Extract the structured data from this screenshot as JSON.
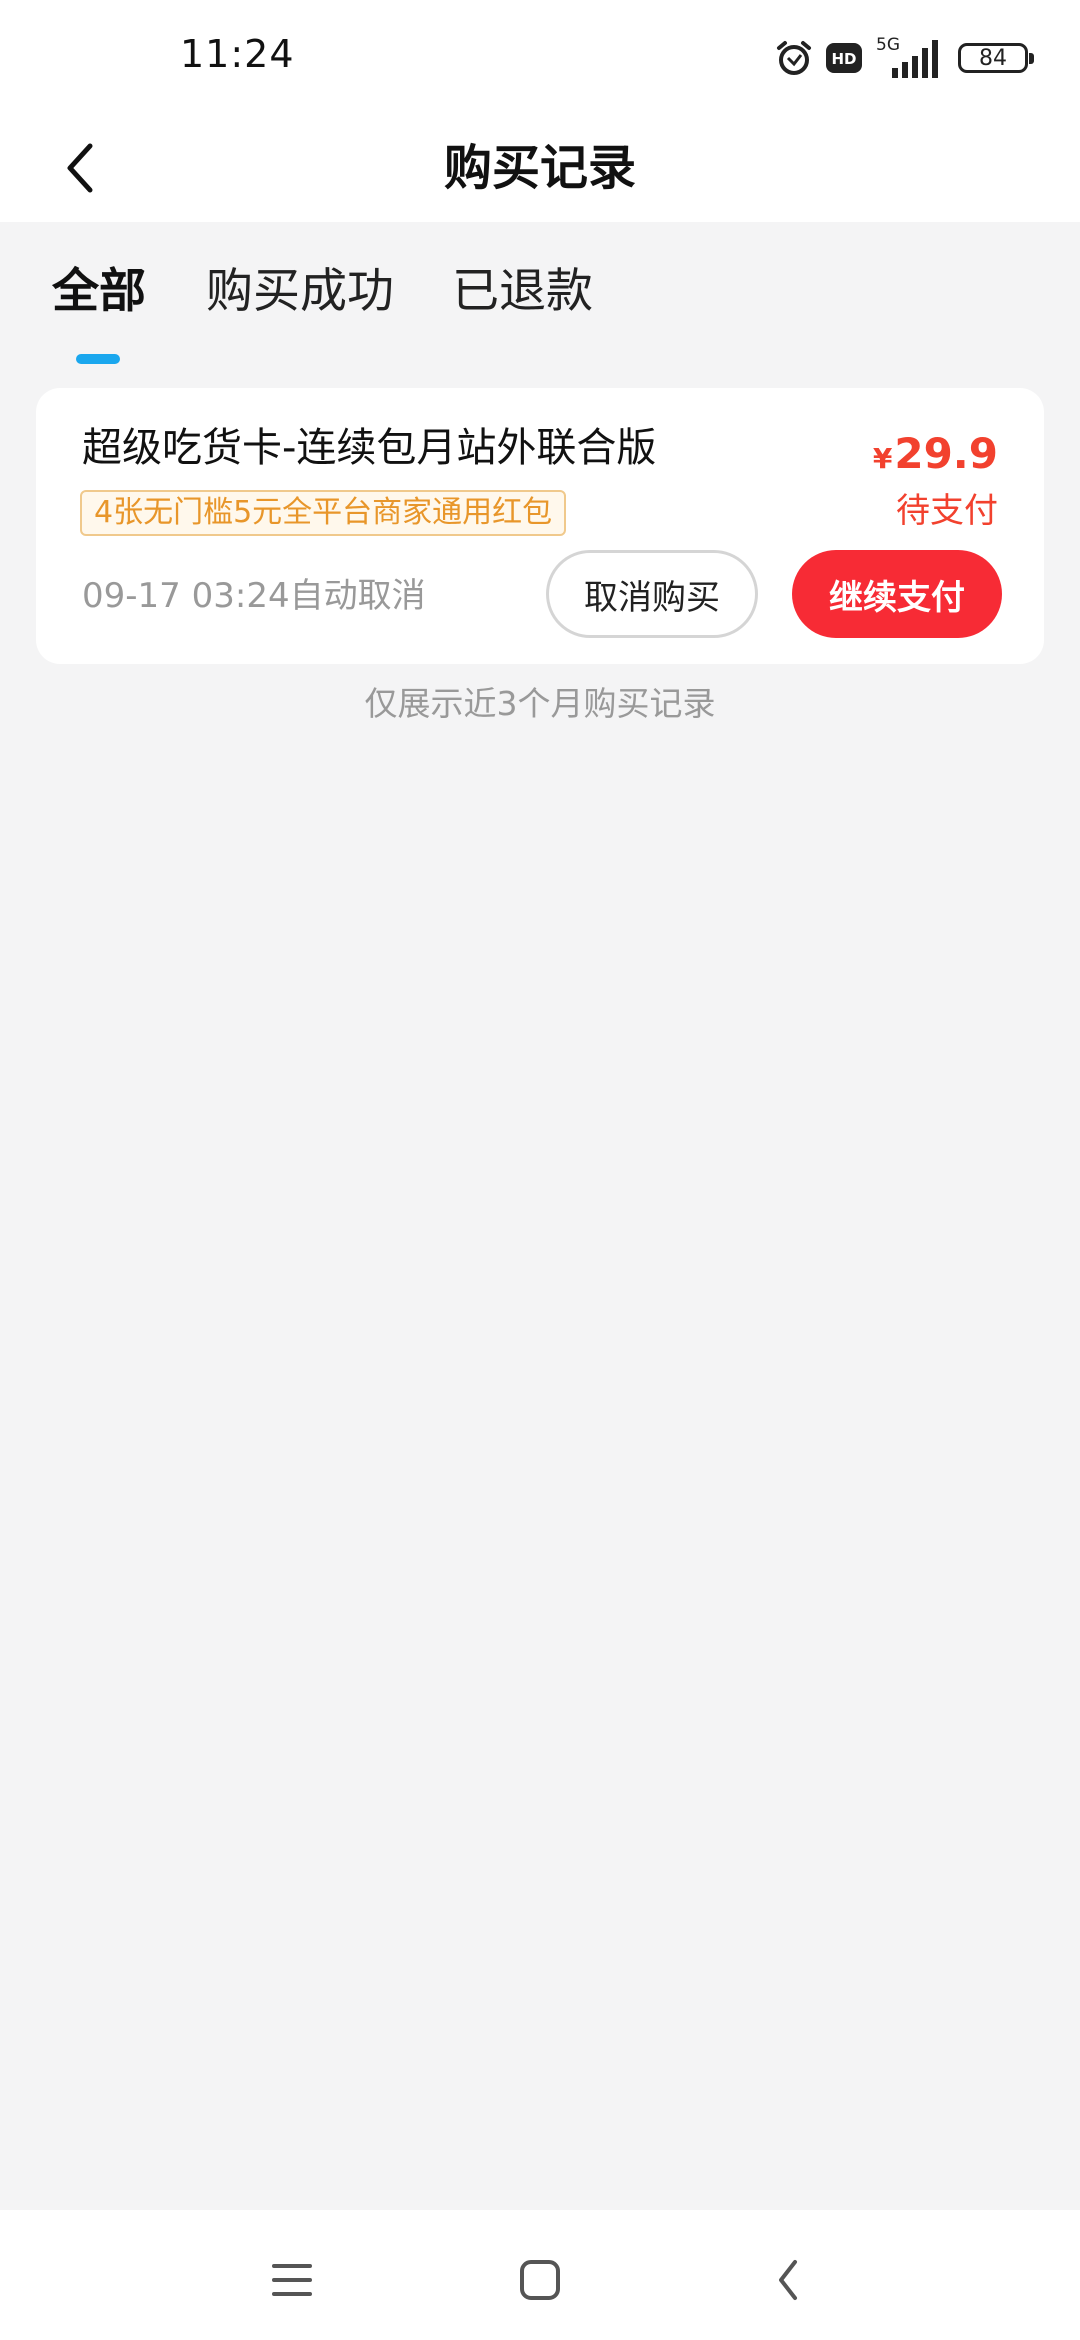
{
  "status_bar": {
    "time": "11:24",
    "network_label": "5G",
    "hd_label": "HD",
    "battery_level": "84",
    "icons": [
      "alarm-icon",
      "hd-icon",
      "signal-icon",
      "battery-icon"
    ]
  },
  "header": {
    "title": "购买记录",
    "back_icon": "chevron-left-icon"
  },
  "tabs": [
    {
      "label": "全部",
      "active": true
    },
    {
      "label": "购买成功",
      "active": false
    },
    {
      "label": "已退款",
      "active": false
    }
  ],
  "orders": [
    {
      "product_name": "超级吃货卡-连续包月站外联合版",
      "promo_tag": "4张无门槛5元全平台商家通用红包",
      "currency_symbol": "¥",
      "price": "29.9",
      "status": "待支付",
      "cancel_time": "09-17 03:24自动取消",
      "cancel_button": "取消购买",
      "pay_button": "继续支付"
    }
  ],
  "footer_note": "仅展示近3个月购买记录",
  "colors": {
    "accent_red": "#f72b35",
    "price_red": "#f2412e",
    "tab_indicator": "#1aa7ee",
    "promo_text": "#e8962a",
    "background": "#f4f4f5"
  },
  "system_nav": {
    "icons": [
      "menu-icon",
      "home-icon",
      "back-icon"
    ]
  }
}
